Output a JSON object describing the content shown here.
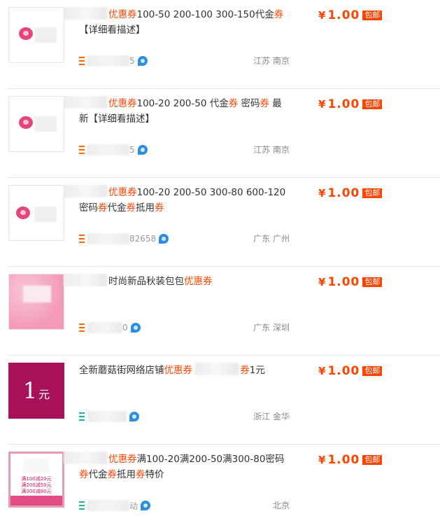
{
  "price_currency": "¥",
  "badge_text": "包邮",
  "accent_color": "#f40",
  "items": [
    {
      "title_segments": [
        "优惠券",
        "100-50 200-100 300-150代金",
        "券",
        "【详细看描述】"
      ],
      "seller_tail": "5",
      "location": "江苏 南京",
      "price": "1.00",
      "thumb": "flower-logo"
    },
    {
      "title_segments": [
        "优惠券",
        "100-20 200-50 代金",
        "券",
        " 密码",
        "券",
        " 最新【详细看描述】"
      ],
      "seller_tail": "5",
      "location": "江苏 南京",
      "price": "1.00",
      "thumb": "flower-logo"
    },
    {
      "title_segments": [
        "优惠券",
        "100-20 200-50 300-80 600-120密码",
        "券",
        "代金",
        "券",
        "抵用",
        "券"
      ],
      "seller_tail": "82658",
      "location": "广东 广州",
      "price": "1.00",
      "thumb": "flower-logo"
    },
    {
      "title_segments": [
        "时尚新品秋装包包",
        "优惠券"
      ],
      "seller_tail": "0",
      "location": "广东 深圳",
      "price": "1.00",
      "thumb": "pink-pattern"
    },
    {
      "title_segments": [
        "全新蘑菇街网络店铺",
        "优惠券",
        " ",
        "券",
        "1元"
      ],
      "seller_tail": "",
      "location": "浙江 金华",
      "price": "1.00",
      "thumb": "coupon-1yuan",
      "thumb_text": {
        "big": "1",
        "small": "元"
      }
    },
    {
      "title_segments": [
        "优惠券",
        "满100-20满200-50满300-80密码",
        "券",
        "代金",
        "券",
        "抵用",
        "券",
        "特价"
      ],
      "seller_tail": "动",
      "location": "北京",
      "price": "1.00",
      "thumb": "coupon-multi",
      "thumb_lines": [
        "满100减20元",
        "满200减50元",
        "满300减80元"
      ]
    }
  ]
}
